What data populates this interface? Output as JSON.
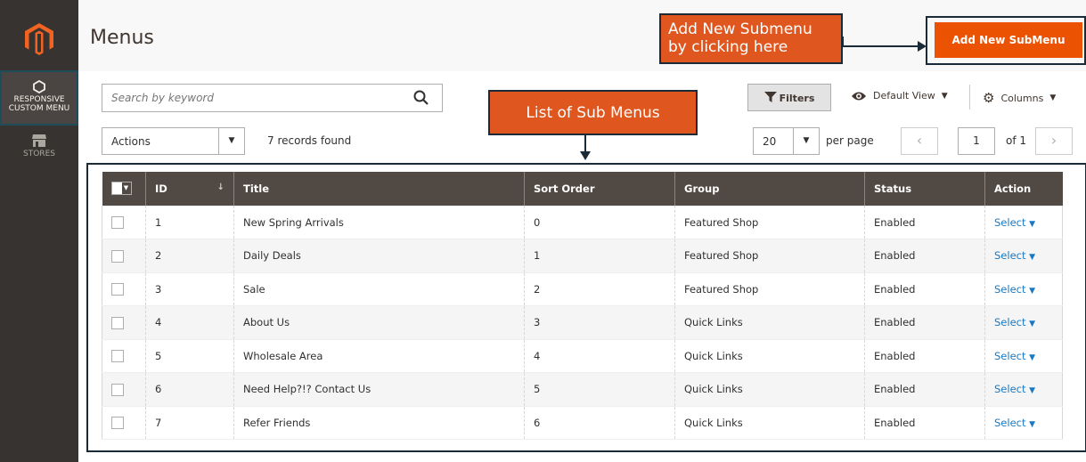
{
  "sidebar": {
    "items": [
      {
        "label_line1": "RESPONSIVE",
        "label_line2": "CUSTOM MENU",
        "icon": "hexagon-icon"
      },
      {
        "label": "STORES",
        "icon": "store-icon"
      }
    ]
  },
  "header": {
    "title": "Menus",
    "add_button_label": "Add New SubMenu"
  },
  "annotations": {
    "add_new_line1": "Add New Submenu",
    "add_new_line2": "by clicking here",
    "list_label": "List of Sub Menus",
    "color": "#e0561f"
  },
  "toolbar": {
    "search_placeholder": "Search by keyword",
    "filters_label": "Filters",
    "view_label": "Default View",
    "columns_label": "Columns",
    "actions_value": "Actions",
    "records_found": "7 records found",
    "per_page_value": "20",
    "per_page_label": "per page",
    "current_page": "1",
    "of_pages": "of 1"
  },
  "grid": {
    "columns": [
      "ID",
      "Title",
      "Sort Order",
      "Group",
      "Status",
      "Action"
    ],
    "rows": [
      {
        "id": "1",
        "title": "New Spring Arrivals",
        "sort": "0",
        "group": "Featured Shop",
        "status": "Enabled",
        "action": "Select"
      },
      {
        "id": "2",
        "title": "Daily Deals",
        "sort": "1",
        "group": "Featured Shop",
        "status": "Enabled",
        "action": "Select"
      },
      {
        "id": "3",
        "title": "Sale",
        "sort": "2",
        "group": "Featured Shop",
        "status": "Enabled",
        "action": "Select"
      },
      {
        "id": "4",
        "title": "About Us",
        "sort": "3",
        "group": "Quick Links",
        "status": "Enabled",
        "action": "Select"
      },
      {
        "id": "5",
        "title": "Wholesale Area",
        "sort": "4",
        "group": "Quick Links",
        "status": "Enabled",
        "action": "Select"
      },
      {
        "id": "6",
        "title": "Need Help?!? Contact Us",
        "sort": "5",
        "group": "Quick Links",
        "status": "Enabled",
        "action": "Select"
      },
      {
        "id": "7",
        "title": "Refer Friends",
        "sort": "6",
        "group": "Quick Links",
        "status": "Enabled",
        "action": "Select"
      }
    ]
  },
  "colors": {
    "sidebar": "#373330",
    "grid_header": "#514943",
    "primary_button": "#eb5202",
    "link": "#1979c3"
  }
}
